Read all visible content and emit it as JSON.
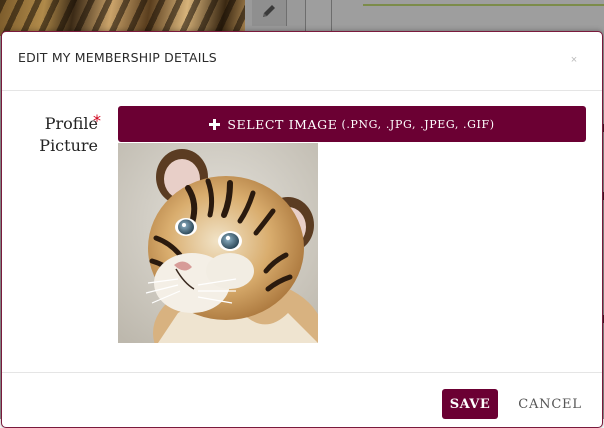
{
  "modal": {
    "title": "EDIT MY MEMBERSHIP DETAILS",
    "close_label": "×",
    "accent_color": "#6b0033"
  },
  "form": {
    "profile_picture_label": "Profile Picture",
    "required_marker": "*",
    "select_image": {
      "label": "SELECT IMAGE",
      "extensions": "(.PNG, .JPG, .JPEG, .GIF)",
      "icon": "plus-icon"
    },
    "preview_image": "tiger-cub-photo"
  },
  "footer": {
    "save_label": "SAVE",
    "cancel_label": "CANCEL"
  },
  "background_page": {
    "edit_icon": "pencil-icon"
  }
}
